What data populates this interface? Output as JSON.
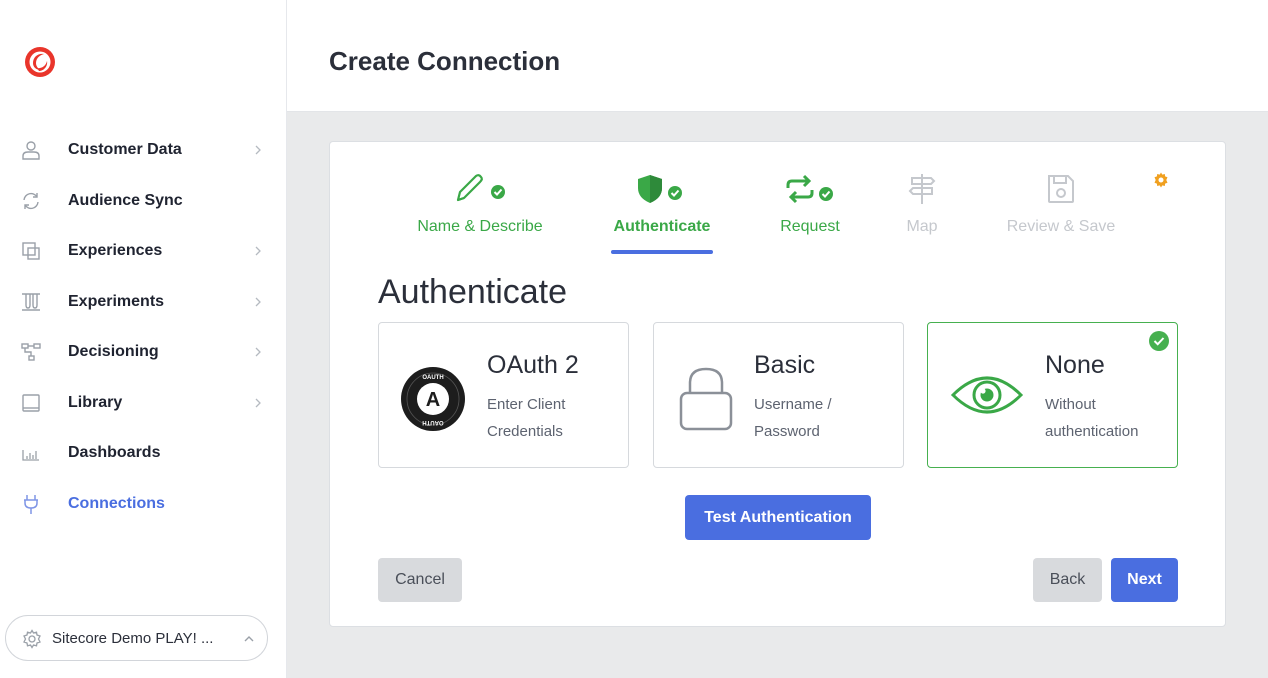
{
  "sidebar": {
    "items": [
      {
        "label": "Customer Data",
        "icon": "person-icon",
        "chevron": true
      },
      {
        "label": "Audience Sync",
        "icon": "sync-icon",
        "chevron": false
      },
      {
        "label": "Experiences",
        "icon": "experiences-icon",
        "chevron": true
      },
      {
        "label": "Experiments",
        "icon": "experiments-icon",
        "chevron": true
      },
      {
        "label": "Decisioning",
        "icon": "decisioning-icon",
        "chevron": true
      },
      {
        "label": "Library",
        "icon": "library-icon",
        "chevron": true
      },
      {
        "label": "Dashboards",
        "icon": "dashboards-icon",
        "chevron": false
      },
      {
        "label": "Connections",
        "icon": "plug-icon",
        "chevron": false,
        "active": true
      }
    ],
    "tenant": "Sitecore Demo PLAY! ..."
  },
  "header": {
    "title": "Create Connection"
  },
  "wizard": {
    "steps": [
      {
        "label": "Name & Describe",
        "state": "done"
      },
      {
        "label": "Authenticate",
        "state": "current"
      },
      {
        "label": "Request",
        "state": "done"
      },
      {
        "label": "Map",
        "state": "todo"
      },
      {
        "label": "Review & Save",
        "state": "todo"
      }
    ],
    "section_title": "Authenticate",
    "auth_options": [
      {
        "title": "OAuth 2",
        "subtitle": "Enter Client Credentials",
        "badge_top": "OAUTH",
        "badge_letter": "A",
        "badge_bottom": "OAUTH"
      },
      {
        "title": "Basic",
        "subtitle": "Username / Password"
      },
      {
        "title": "None",
        "subtitle": "Without authentication",
        "selected": true
      }
    ],
    "test_button": "Test Authentication",
    "cancel_button": "Cancel",
    "back_button": "Back",
    "next_button": "Next"
  },
  "colors": {
    "accent": "#4a6ee0",
    "success": "#3aa847",
    "brand": "#e9352b",
    "settings": "#f0a020"
  }
}
